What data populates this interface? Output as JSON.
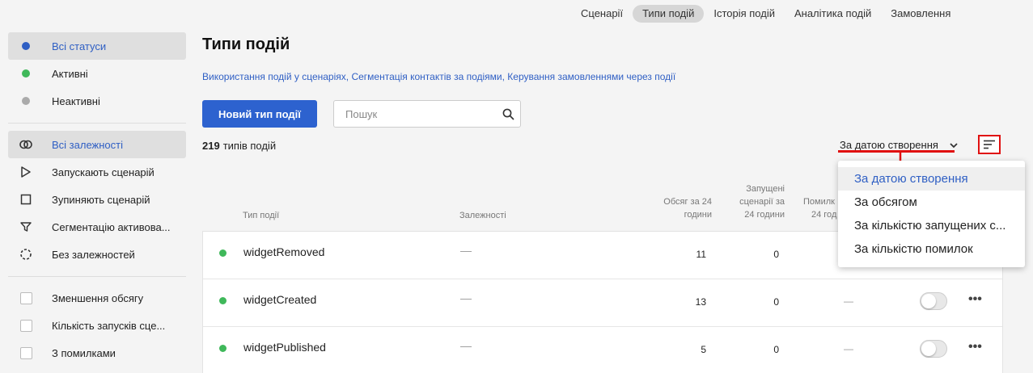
{
  "topnav": {
    "tabs": [
      {
        "label": "Сценарії",
        "active": false
      },
      {
        "label": "Типи подій",
        "active": true
      },
      {
        "label": "Історія подій",
        "active": false
      },
      {
        "label": "Аналітика подій",
        "active": false
      },
      {
        "label": "Замовлення",
        "active": false
      }
    ]
  },
  "sidebar": {
    "status_filters": [
      {
        "label": "Всі статуси",
        "color": "#2f5fc4",
        "selected": true
      },
      {
        "label": "Активні",
        "color": "#3fb85a",
        "selected": false
      },
      {
        "label": "Неактивні",
        "color": "#aaaaaa",
        "selected": false
      }
    ],
    "dependency_filters": [
      {
        "label": "Всі залежності",
        "icon": "link-icon",
        "selected": true
      },
      {
        "label": "Запускають сценарій",
        "icon": "play-icon",
        "selected": false
      },
      {
        "label": "Зупиняють сценарій",
        "icon": "stop-icon",
        "selected": false
      },
      {
        "label": "Сегментацію активова...",
        "icon": "funnel-icon",
        "selected": false
      },
      {
        "label": "Без залежностей",
        "icon": "dashed-circle-icon",
        "selected": false
      }
    ],
    "checkbox_filters": [
      {
        "label": "Зменшення обсягу",
        "checked": false
      },
      {
        "label": "Кількість запусків сце...",
        "checked": false
      },
      {
        "label": "З помилками",
        "checked": false
      }
    ]
  },
  "main": {
    "title": "Типи подій",
    "links": [
      "Використання подій у сценаріях",
      "Сегментація контактів за подіями",
      "Керування замовленнями через події"
    ],
    "link_separator": ", ",
    "new_button": "Новий тип події",
    "search_placeholder": "Пошук",
    "count_number": "219",
    "count_label": "типів подій",
    "sort_selected": "За датою створення"
  },
  "table": {
    "headers": {
      "type": "Тип події",
      "dependencies": "Залежності",
      "volume_line1": "Обсяг за 24",
      "volume_line2": "години",
      "runs_line1": "Запущені",
      "runs_line2": "сценарії за",
      "runs_line3": "24 години",
      "errors_line1": "Помилк",
      "errors_line2": "24 год"
    },
    "rows": [
      {
        "name": "widgetRemoved",
        "dependencies": "—",
        "volume": "11",
        "runs": "0",
        "errors": "—",
        "status_color": "#3fb85a"
      },
      {
        "name": "widgetCreated",
        "dependencies": "—",
        "volume": "13",
        "runs": "0",
        "errors": "—",
        "status_color": "#3fb85a"
      },
      {
        "name": "widgetPublished",
        "dependencies": "—",
        "volume": "5",
        "runs": "0",
        "errors": "—",
        "status_color": "#3fb85a"
      }
    ]
  },
  "sort_dropdown": {
    "options": [
      {
        "label": "За датою створення",
        "selected": true
      },
      {
        "label": "За обсягом",
        "selected": false
      },
      {
        "label": "За кількістю запущених с...",
        "selected": false
      },
      {
        "label": "За кількістю помилок",
        "selected": false
      }
    ]
  },
  "annotations": {
    "highlight_color": "#e01010"
  }
}
